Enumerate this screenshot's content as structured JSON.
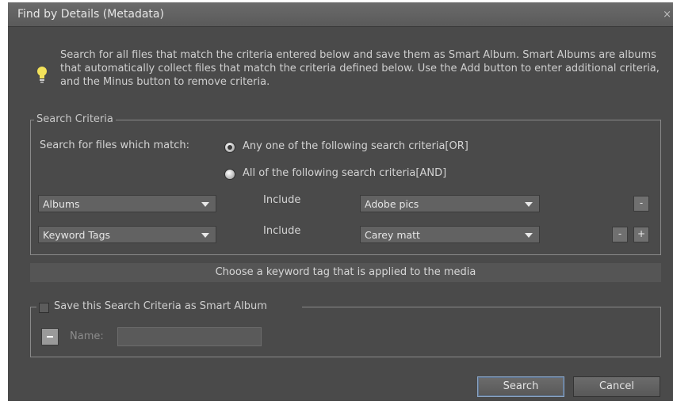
{
  "window": {
    "title": "Find by Details (Metadata)",
    "close_glyph": "×"
  },
  "info": {
    "icon": "lightbulb-icon",
    "text": "Search for all files that match the criteria entered below and save them as Smart Album. Smart Albums are albums that automatically collect files that match the criteria defined below. Use the Add button to enter additional criteria, and the Minus button to remove criteria."
  },
  "criteria": {
    "legend": "Search Criteria",
    "match_label": "Search for files which match:",
    "option_or": "Any one of the following search criteria[OR]",
    "option_and": "All of the following search criteria[AND]",
    "selected": "or",
    "rows": [
      {
        "field": "Albums",
        "operator": "Include",
        "value": "Adobe pics",
        "buttons": [
          "-"
        ]
      },
      {
        "field": "Keyword Tags",
        "operator": "Include",
        "value": "Carey matt",
        "buttons": [
          "-",
          "+"
        ]
      }
    ]
  },
  "hint": "Choose a keyword tag that is applied to the media",
  "smart_album": {
    "legend": "Save this Search Criteria as Smart Album",
    "checked": false,
    "name_label": "Name:",
    "name_value": ""
  },
  "buttons": {
    "search": "Search",
    "cancel": "Cancel"
  },
  "colors": {
    "dialog_bg": "#4a4a4a",
    "titlebar": "#5a5a5a",
    "bulb": "#f3e25a",
    "primary_border": "#8aa4c4"
  }
}
